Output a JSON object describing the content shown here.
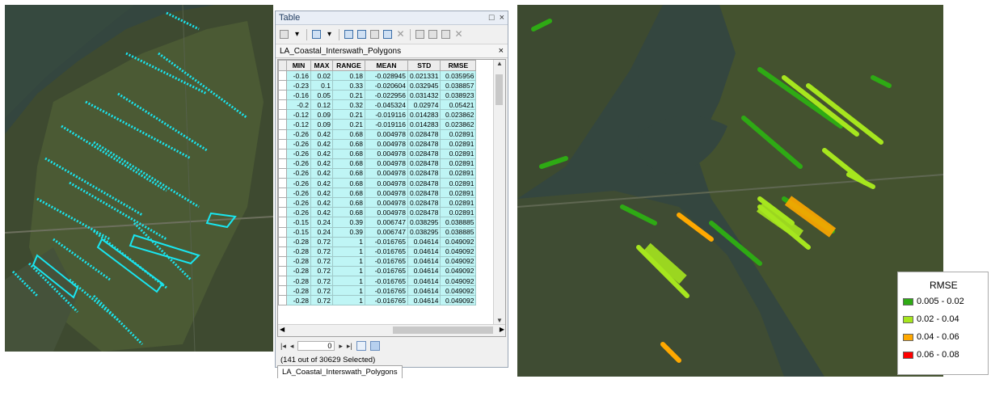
{
  "table_window": {
    "title": "Table",
    "minimize_label": "□",
    "close_label": "×",
    "tab_label": "LA_Coastal_Interswath_Polygons",
    "tab_close": "×",
    "columns": [
      "MIN",
      "MAX",
      "RANGE",
      "MEAN",
      "STD",
      "RMSE"
    ],
    "rows": [
      [
        "-0.16",
        "0.02",
        "0.18",
        "-0.028945",
        "0.021331",
        "0.035956"
      ],
      [
        "-0.23",
        "0.1",
        "0.33",
        "-0.020604",
        "0.032945",
        "0.038857"
      ],
      [
        "-0.16",
        "0.05",
        "0.21",
        "-0.022956",
        "0.031432",
        "0.038923"
      ],
      [
        "-0.2",
        "0.12",
        "0.32",
        "-0.045324",
        "0.02974",
        "0.05421"
      ],
      [
        "-0.12",
        "0.09",
        "0.21",
        "-0.019116",
        "0.014283",
        "0.023862"
      ],
      [
        "-0.12",
        "0.09",
        "0.21",
        "-0.019116",
        "0.014283",
        "0.023862"
      ],
      [
        "-0.26",
        "0.42",
        "0.68",
        "0.004978",
        "0.028478",
        "0.02891"
      ],
      [
        "-0.26",
        "0.42",
        "0.68",
        "0.004978",
        "0.028478",
        "0.02891"
      ],
      [
        "-0.26",
        "0.42",
        "0.68",
        "0.004978",
        "0.028478",
        "0.02891"
      ],
      [
        "-0.26",
        "0.42",
        "0.68",
        "0.004978",
        "0.028478",
        "0.02891"
      ],
      [
        "-0.26",
        "0.42",
        "0.68",
        "0.004978",
        "0.028478",
        "0.02891"
      ],
      [
        "-0.26",
        "0.42",
        "0.68",
        "0.004978",
        "0.028478",
        "0.02891"
      ],
      [
        "-0.26",
        "0.42",
        "0.68",
        "0.004978",
        "0.028478",
        "0.02891"
      ],
      [
        "-0.26",
        "0.42",
        "0.68",
        "0.004978",
        "0.028478",
        "0.02891"
      ],
      [
        "-0.26",
        "0.42",
        "0.68",
        "0.004978",
        "0.028478",
        "0.02891"
      ],
      [
        "-0.15",
        "0.24",
        "0.39",
        "0.006747",
        "0.038295",
        "0.038885"
      ],
      [
        "-0.15",
        "0.24",
        "0.39",
        "0.006747",
        "0.038295",
        "0.038885"
      ],
      [
        "-0.28",
        "0.72",
        "1",
        "-0.016765",
        "0.04614",
        "0.049092"
      ],
      [
        "-0.28",
        "0.72",
        "1",
        "-0.016765",
        "0.04614",
        "0.049092"
      ],
      [
        "-0.28",
        "0.72",
        "1",
        "-0.016765",
        "0.04614",
        "0.049092"
      ],
      [
        "-0.28",
        "0.72",
        "1",
        "-0.016765",
        "0.04614",
        "0.049092"
      ],
      [
        "-0.28",
        "0.72",
        "1",
        "-0.016765",
        "0.04614",
        "0.049092"
      ],
      [
        "-0.28",
        "0.72",
        "1",
        "-0.016765",
        "0.04614",
        "0.049092"
      ],
      [
        "-0.28",
        "0.72",
        "1",
        "-0.016765",
        "0.04614",
        "0.049092"
      ]
    ],
    "nav": {
      "first": "|◂",
      "prev": "◂",
      "record": "0",
      "next": "▸",
      "last": "▸|"
    },
    "status": "(141 out of 30629 Selected)",
    "bottom_tab": "LA_Coastal_Interswath_Polygons"
  },
  "legend": {
    "title": "RMSE",
    "items": [
      {
        "label": "0.005 - 0.02",
        "color": "#2eaa14"
      },
      {
        "label": "0.02 - 0.04",
        "color": "#a6e61e"
      },
      {
        "label": "0.04 - 0.06",
        "color": "#ffa800"
      },
      {
        "label": "0.06 - 0.08",
        "color": "#ff0000"
      }
    ]
  },
  "colors": {
    "selection_cyan": "#19e6f0",
    "map_land": "#3e4a2e",
    "map_water": "#34463f"
  }
}
